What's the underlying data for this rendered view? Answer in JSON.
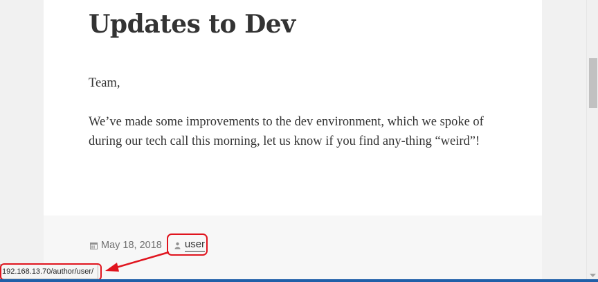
{
  "post": {
    "title": "Updates to Dev",
    "paragraphs": [
      "Team,",
      "We’ve made some improvements to the dev environment, which we spoke of during our tech call this morning, let us know if you find any-thing “weird”!"
    ]
  },
  "meta": {
    "date": "May 18, 2018",
    "author": "user",
    "calendar_icon": "calendar-icon",
    "author_icon": "person-icon"
  },
  "status_bar": {
    "url": "192.168.13.70/author/user/"
  },
  "annotation": {
    "color": "#e0141e"
  }
}
